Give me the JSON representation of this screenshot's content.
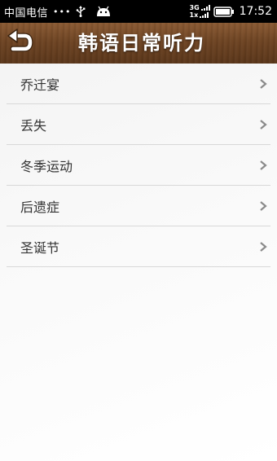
{
  "status_bar": {
    "carrier": "中国电信",
    "dots": "•••",
    "network_top": "3G",
    "network_bottom": "1x",
    "time": "17:52"
  },
  "header": {
    "title": "韩语日常听力",
    "back_icon": "back-arrow-icon",
    "accent_color": "#6e4423"
  },
  "list": {
    "items": [
      {
        "label": "乔迁宴"
      },
      {
        "label": "丢失"
      },
      {
        "label": "冬季运动"
      },
      {
        "label": "后遗症"
      },
      {
        "label": "圣诞节"
      }
    ]
  }
}
